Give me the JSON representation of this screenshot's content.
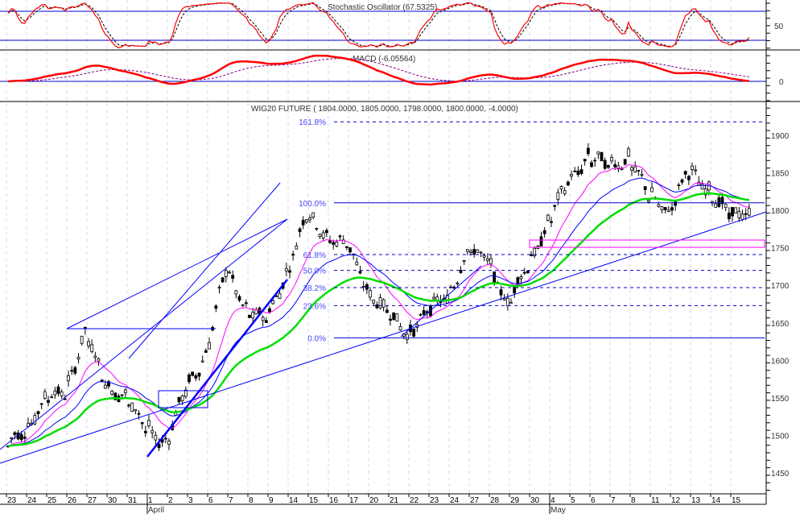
{
  "chart_data": {
    "type": "line",
    "title": "WIG20 FUTURE ( 1804.0000, 1805.0000, 1798.0000, 1800.0000, -4.0000)",
    "panels": {
      "stochastic": {
        "label": "Stochastic Oscillator (67.5325)",
        "levels": [
          80,
          20
        ],
        "tick_labels": [
          "50"
        ]
      },
      "macd": {
        "label": "MACD (-6.05564)",
        "tick_labels": [
          "0"
        ]
      }
    },
    "price_axis": {
      "ylim": [
        1430,
        1930
      ],
      "ticks": [
        "1900",
        "1850",
        "1800",
        "1750",
        "1700",
        "1650",
        "1600",
        "1550",
        "1500",
        "1450"
      ]
    },
    "x_axis": {
      "days": [
        "23",
        "24",
        "25",
        "26",
        "27",
        "30",
        "31",
        "1",
        "2",
        "3",
        "6",
        "7",
        "8",
        "9",
        "14",
        "15",
        "16",
        "17",
        "20",
        "21",
        "22",
        "23",
        "24",
        "27",
        "28",
        "29",
        "30",
        "4",
        "5",
        "6",
        "7",
        "8",
        "11",
        "12",
        "13",
        "14",
        "15"
      ],
      "months": [
        {
          "label": "April",
          "start_index": 7
        },
        {
          "label": "May",
          "start_index": 27
        }
      ]
    },
    "daily_close": [
      1510,
      1545,
      1560,
      1635,
      1570,
      1550,
      1510,
      1490,
      1560,
      1610,
      1720,
      1670,
      1650,
      1720,
      1790,
      1770,
      1750,
      1700,
      1660,
      1640,
      1660,
      1690,
      1740,
      1740,
      1670,
      1730,
      1780,
      1840,
      1870,
      1860,
      1870,
      1820,
      1800,
      1850,
      1830,
      1790,
      1800
    ],
    "fibonacci": [
      {
        "label": "161.8%",
        "value": 1918
      },
      {
        "label": "100.0%",
        "value": 1810
      },
      {
        "label": "61.8%",
        "value": 1741
      },
      {
        "label": "50.0%",
        "value": 1720
      },
      {
        "label": "38.2%",
        "value": 1697
      },
      {
        "label": "23.6%",
        "value": 1673
      },
      {
        "label": "0.0%",
        "value": 1630
      }
    ],
    "series": [
      {
        "name": "price",
        "color": "#000000"
      },
      {
        "name": "ma-short",
        "color": "#ff00ff"
      },
      {
        "name": "ma-mid",
        "color": "#0000ff"
      },
      {
        "name": "ma-long",
        "color": "#00dd00"
      },
      {
        "name": "stoch-k",
        "color": "#ff0000"
      },
      {
        "name": "macd",
        "color": "#ff0000"
      }
    ]
  }
}
